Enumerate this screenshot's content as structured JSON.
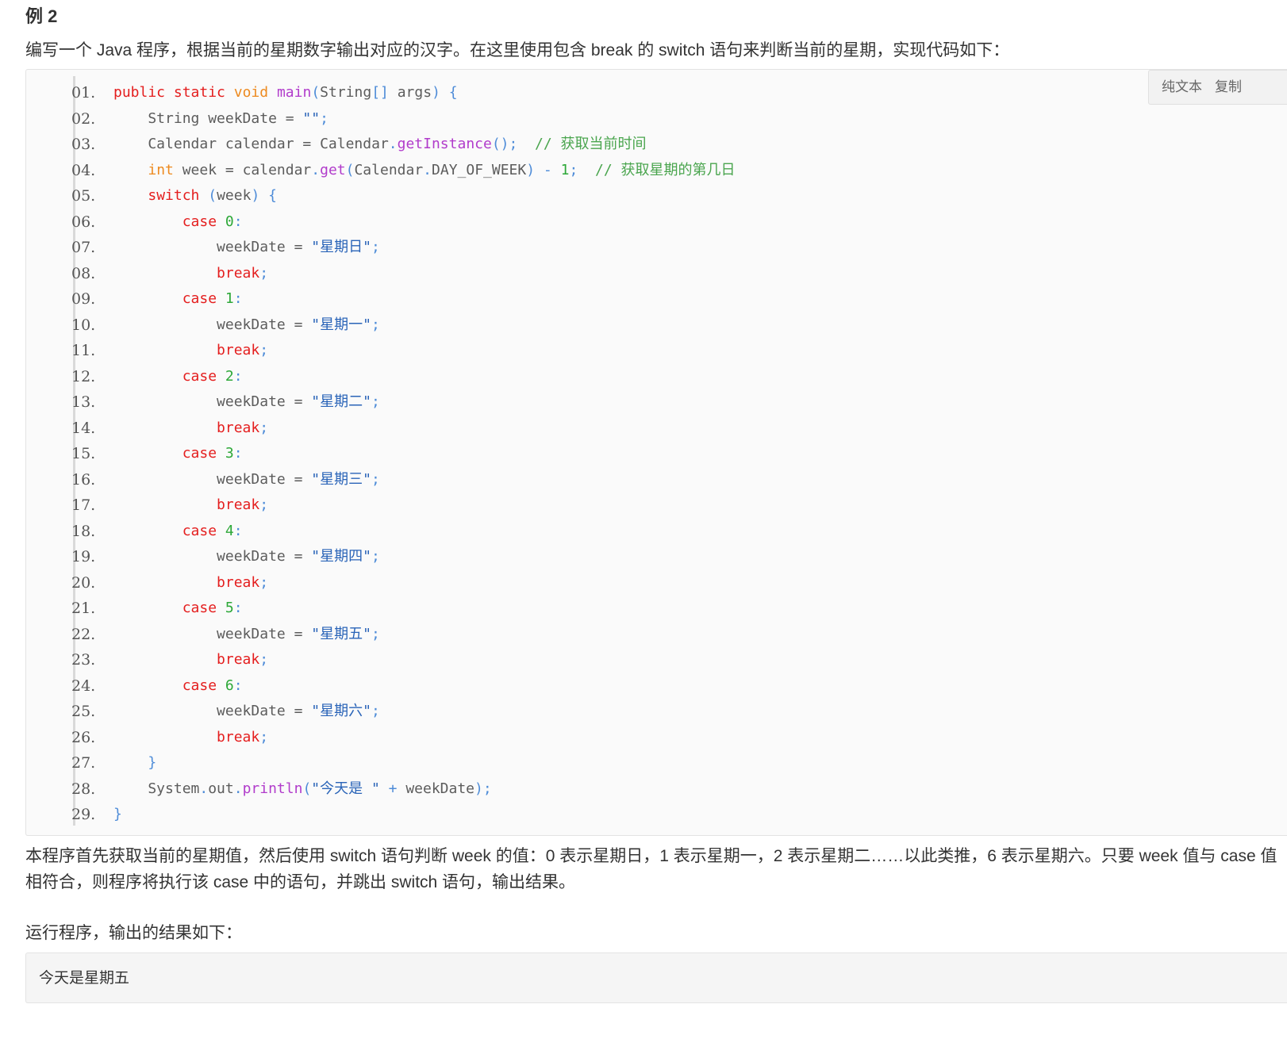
{
  "heading": "例 2",
  "intro": "编写一个 Java 程序，根据当前的星期数字输出对应的汉字。在这里使用包含 break 的 switch 语句来判断当前的星期，实现代码如下：",
  "toolbar": {
    "plain_text_label": "纯文本",
    "copy_label": "复制"
  },
  "code": {
    "language": "java",
    "lines": [
      {
        "no": "01.",
        "tokens": [
          {
            "t": "kw",
            "v": "public"
          },
          {
            "t": "pl",
            "v": " "
          },
          {
            "t": "kw",
            "v": "static"
          },
          {
            "t": "pl",
            "v": " "
          },
          {
            "t": "typ",
            "v": "void"
          },
          {
            "t": "pl",
            "v": " "
          },
          {
            "t": "fn",
            "v": "main"
          },
          {
            "t": "p",
            "v": "("
          },
          {
            "t": "pl",
            "v": "String"
          },
          {
            "t": "p",
            "v": "[]"
          },
          {
            "t": "pl",
            "v": " args"
          },
          {
            "t": "p",
            "v": ")"
          },
          {
            "t": "pl",
            "v": " "
          },
          {
            "t": "p",
            "v": "{"
          }
        ]
      },
      {
        "no": "02.",
        "tokens": [
          {
            "t": "pl",
            "v": "    String weekDate = "
          },
          {
            "t": "str",
            "v": "\"\""
          },
          {
            "t": "p",
            "v": ";"
          }
        ]
      },
      {
        "no": "03.",
        "tokens": [
          {
            "t": "pl",
            "v": "    Calendar calendar = Calendar"
          },
          {
            "t": "p",
            "v": "."
          },
          {
            "t": "fn",
            "v": "getInstance"
          },
          {
            "t": "p",
            "v": "();"
          },
          {
            "t": "pl",
            "v": "  "
          },
          {
            "t": "com",
            "v": "// 获取当前时间"
          }
        ]
      },
      {
        "no": "04.",
        "tokens": [
          {
            "t": "pl",
            "v": "    "
          },
          {
            "t": "typ",
            "v": "int"
          },
          {
            "t": "pl",
            "v": " week = calendar"
          },
          {
            "t": "p",
            "v": "."
          },
          {
            "t": "fn",
            "v": "get"
          },
          {
            "t": "p",
            "v": "("
          },
          {
            "t": "pl",
            "v": "Calendar"
          },
          {
            "t": "p",
            "v": "."
          },
          {
            "t": "pl",
            "v": "DAY_OF_WEEK"
          },
          {
            "t": "p",
            "v": ")"
          },
          {
            "t": "pl",
            "v": " "
          },
          {
            "t": "p",
            "v": "-"
          },
          {
            "t": "pl",
            "v": " "
          },
          {
            "t": "num",
            "v": "1"
          },
          {
            "t": "p",
            "v": ";"
          },
          {
            "t": "pl",
            "v": "  "
          },
          {
            "t": "com",
            "v": "// 获取星期的第几日"
          }
        ]
      },
      {
        "no": "05.",
        "tokens": [
          {
            "t": "pl",
            "v": "    "
          },
          {
            "t": "kw",
            "v": "switch"
          },
          {
            "t": "pl",
            "v": " "
          },
          {
            "t": "p",
            "v": "("
          },
          {
            "t": "pl",
            "v": "week"
          },
          {
            "t": "p",
            "v": ")"
          },
          {
            "t": "pl",
            "v": " "
          },
          {
            "t": "p",
            "v": "{"
          }
        ]
      },
      {
        "no": "06.",
        "tokens": [
          {
            "t": "pl",
            "v": "        "
          },
          {
            "t": "kw",
            "v": "case"
          },
          {
            "t": "pl",
            "v": " "
          },
          {
            "t": "num",
            "v": "0"
          },
          {
            "t": "p",
            "v": ":"
          }
        ]
      },
      {
        "no": "07.",
        "tokens": [
          {
            "t": "pl",
            "v": "            weekDate = "
          },
          {
            "t": "str",
            "v": "\"星期日\""
          },
          {
            "t": "p",
            "v": ";"
          }
        ]
      },
      {
        "no": "08.",
        "tokens": [
          {
            "t": "pl",
            "v": "            "
          },
          {
            "t": "kw",
            "v": "break"
          },
          {
            "t": "p",
            "v": ";"
          }
        ]
      },
      {
        "no": "09.",
        "tokens": [
          {
            "t": "pl",
            "v": "        "
          },
          {
            "t": "kw",
            "v": "case"
          },
          {
            "t": "pl",
            "v": " "
          },
          {
            "t": "num",
            "v": "1"
          },
          {
            "t": "p",
            "v": ":"
          }
        ]
      },
      {
        "no": "10.",
        "tokens": [
          {
            "t": "pl",
            "v": "            weekDate = "
          },
          {
            "t": "str",
            "v": "\"星期一\""
          },
          {
            "t": "p",
            "v": ";"
          }
        ]
      },
      {
        "no": "11.",
        "tokens": [
          {
            "t": "pl",
            "v": "            "
          },
          {
            "t": "kw",
            "v": "break"
          },
          {
            "t": "p",
            "v": ";"
          }
        ]
      },
      {
        "no": "12.",
        "tokens": [
          {
            "t": "pl",
            "v": "        "
          },
          {
            "t": "kw",
            "v": "case"
          },
          {
            "t": "pl",
            "v": " "
          },
          {
            "t": "num",
            "v": "2"
          },
          {
            "t": "p",
            "v": ":"
          }
        ]
      },
      {
        "no": "13.",
        "tokens": [
          {
            "t": "pl",
            "v": "            weekDate = "
          },
          {
            "t": "str",
            "v": "\"星期二\""
          },
          {
            "t": "p",
            "v": ";"
          }
        ]
      },
      {
        "no": "14.",
        "tokens": [
          {
            "t": "pl",
            "v": "            "
          },
          {
            "t": "kw",
            "v": "break"
          },
          {
            "t": "p",
            "v": ";"
          }
        ]
      },
      {
        "no": "15.",
        "tokens": [
          {
            "t": "pl",
            "v": "        "
          },
          {
            "t": "kw",
            "v": "case"
          },
          {
            "t": "pl",
            "v": " "
          },
          {
            "t": "num",
            "v": "3"
          },
          {
            "t": "p",
            "v": ":"
          }
        ]
      },
      {
        "no": "16.",
        "tokens": [
          {
            "t": "pl",
            "v": "            weekDate = "
          },
          {
            "t": "str",
            "v": "\"星期三\""
          },
          {
            "t": "p",
            "v": ";"
          }
        ]
      },
      {
        "no": "17.",
        "tokens": [
          {
            "t": "pl",
            "v": "            "
          },
          {
            "t": "kw",
            "v": "break"
          },
          {
            "t": "p",
            "v": ";"
          }
        ]
      },
      {
        "no": "18.",
        "tokens": [
          {
            "t": "pl",
            "v": "        "
          },
          {
            "t": "kw",
            "v": "case"
          },
          {
            "t": "pl",
            "v": " "
          },
          {
            "t": "num",
            "v": "4"
          },
          {
            "t": "p",
            "v": ":"
          }
        ]
      },
      {
        "no": "19.",
        "tokens": [
          {
            "t": "pl",
            "v": "            weekDate = "
          },
          {
            "t": "str",
            "v": "\"星期四\""
          },
          {
            "t": "p",
            "v": ";"
          }
        ]
      },
      {
        "no": "20.",
        "tokens": [
          {
            "t": "pl",
            "v": "            "
          },
          {
            "t": "kw",
            "v": "break"
          },
          {
            "t": "p",
            "v": ";"
          }
        ]
      },
      {
        "no": "21.",
        "tokens": [
          {
            "t": "pl",
            "v": "        "
          },
          {
            "t": "kw",
            "v": "case"
          },
          {
            "t": "pl",
            "v": " "
          },
          {
            "t": "num",
            "v": "5"
          },
          {
            "t": "p",
            "v": ":"
          }
        ]
      },
      {
        "no": "22.",
        "tokens": [
          {
            "t": "pl",
            "v": "            weekDate = "
          },
          {
            "t": "str",
            "v": "\"星期五\""
          },
          {
            "t": "p",
            "v": ";"
          }
        ]
      },
      {
        "no": "23.",
        "tokens": [
          {
            "t": "pl",
            "v": "            "
          },
          {
            "t": "kw",
            "v": "break"
          },
          {
            "t": "p",
            "v": ";"
          }
        ]
      },
      {
        "no": "24.",
        "tokens": [
          {
            "t": "pl",
            "v": "        "
          },
          {
            "t": "kw",
            "v": "case"
          },
          {
            "t": "pl",
            "v": " "
          },
          {
            "t": "num",
            "v": "6"
          },
          {
            "t": "p",
            "v": ":"
          }
        ]
      },
      {
        "no": "25.",
        "tokens": [
          {
            "t": "pl",
            "v": "            weekDate = "
          },
          {
            "t": "str",
            "v": "\"星期六\""
          },
          {
            "t": "p",
            "v": ";"
          }
        ]
      },
      {
        "no": "26.",
        "tokens": [
          {
            "t": "pl",
            "v": "            "
          },
          {
            "t": "kw",
            "v": "break"
          },
          {
            "t": "p",
            "v": ";"
          }
        ]
      },
      {
        "no": "27.",
        "tokens": [
          {
            "t": "pl",
            "v": "    "
          },
          {
            "t": "p",
            "v": "}"
          }
        ]
      },
      {
        "no": "28.",
        "tokens": [
          {
            "t": "pl",
            "v": "    System"
          },
          {
            "t": "p",
            "v": "."
          },
          {
            "t": "pl",
            "v": "out"
          },
          {
            "t": "p",
            "v": "."
          },
          {
            "t": "fn",
            "v": "println"
          },
          {
            "t": "p",
            "v": "("
          },
          {
            "t": "str",
            "v": "\"今天是 \""
          },
          {
            "t": "pl",
            "v": " "
          },
          {
            "t": "p",
            "v": "+"
          },
          {
            "t": "pl",
            "v": " weekDate"
          },
          {
            "t": "p",
            "v": ");"
          }
        ]
      },
      {
        "no": "29.",
        "tokens": [
          {
            "t": "p",
            "v": "}"
          }
        ]
      }
    ]
  },
  "explanation": {
    "line1": "本程序首先获取当前的星期值，然后使用 switch 语句判断 week 的值：0 表示星期日，1 表示星期一，2 表示星期二……以此类推，6 表示星期六。只要 week 值与 case 值",
    "line2": "相符合，则程序将执行该 case 中的语句，并跳出 switch 语句，输出结果。"
  },
  "run_label": "运行程序，输出的结果如下：",
  "output": "今天是星期五",
  "colors": {
    "keyword": "#e41e1e",
    "type": "#ed8a1f",
    "function": "#b13ccb",
    "number": "#2da838",
    "comment": "#4aa54e",
    "string": "#2a64b8",
    "punctuation": "#4e8cd8",
    "plain": "#5c5c5c",
    "code_background": "#fafafa"
  }
}
